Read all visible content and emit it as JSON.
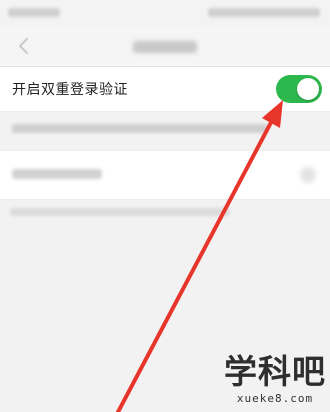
{
  "settings": {
    "two_factor": {
      "label": "开启双重登录验证",
      "enabled": true,
      "toggle_color": "#2db84d"
    }
  },
  "annotation": {
    "arrow_color": "#e8352b"
  },
  "watermark": {
    "text": "学科吧",
    "url": "xueke8.com"
  },
  "icons": {
    "back": "chevron-left-icon"
  }
}
